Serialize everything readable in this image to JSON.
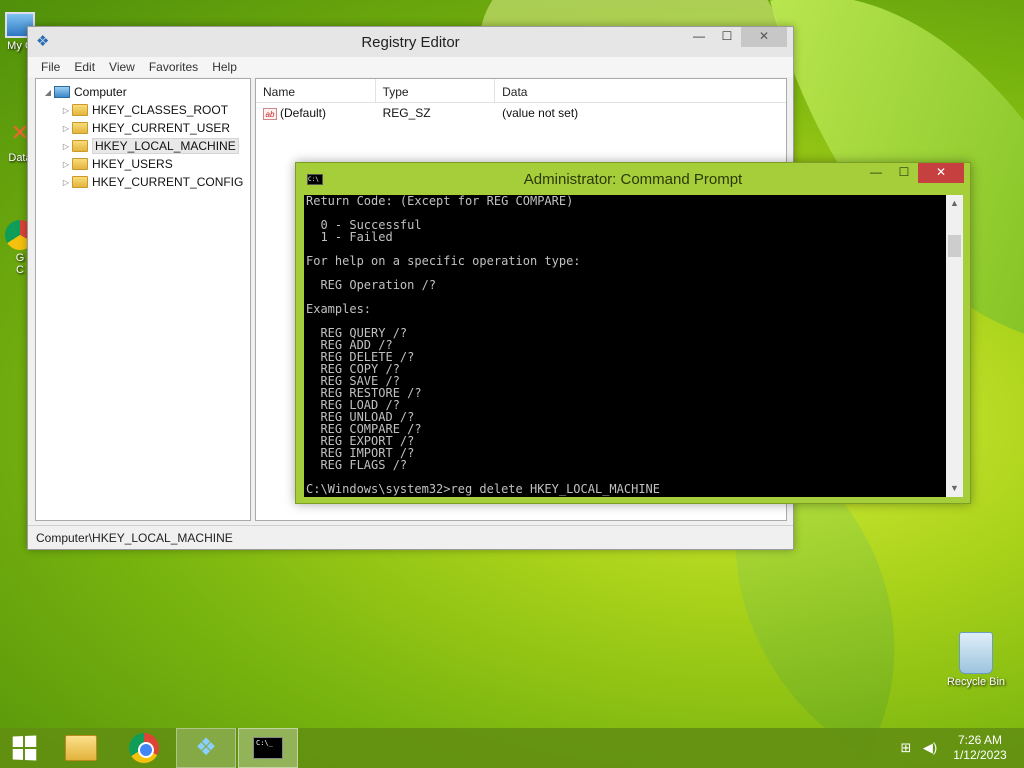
{
  "desktop": {
    "icons": {
      "my_computer": "My C",
      "data": "Data",
      "chrome": "G\nC",
      "recycle_bin": "Recycle Bin"
    }
  },
  "regedit": {
    "title": "Registry Editor",
    "menu": [
      "File",
      "Edit",
      "View",
      "Favorites",
      "Help"
    ],
    "tree": {
      "root": "Computer",
      "items": [
        "HKEY_CLASSES_ROOT",
        "HKEY_CURRENT_USER",
        "HKEY_LOCAL_MACHINE",
        "HKEY_USERS",
        "HKEY_CURRENT_CONFIG"
      ],
      "selected": "HKEY_LOCAL_MACHINE"
    },
    "list": {
      "columns": [
        "Name",
        "Type",
        "Data"
      ],
      "rows": [
        {
          "name": "(Default)",
          "type": "REG_SZ",
          "data": "(value not set)"
        }
      ]
    },
    "status": "Computer\\HKEY_LOCAL_MACHINE"
  },
  "cmd": {
    "title": "Administrator:  Command Prompt",
    "lines": [
      "Return Code: (Except for REG COMPARE)",
      "",
      "  0 - Successful",
      "  1 - Failed",
      "",
      "For help on a specific operation type:",
      "",
      "  REG Operation /?",
      "",
      "Examples:",
      "",
      "  REG QUERY /?",
      "  REG ADD /?",
      "  REG DELETE /?",
      "  REG COPY /?",
      "  REG SAVE /?",
      "  REG RESTORE /?",
      "  REG LOAD /?",
      "  REG UNLOAD /?",
      "  REG COMPARE /?",
      "  REG EXPORT /?",
      "  REG IMPORT /?",
      "  REG FLAGS /?",
      "",
      "C:\\Windows\\system32>reg delete HKEY_LOCAL_MACHINE"
    ]
  },
  "taskbar": {
    "clock_time": "7:26 AM",
    "clock_date": "1/12/2023"
  },
  "window_buttons": {
    "minimize": "—",
    "maximize": "☐",
    "close": "✕"
  }
}
